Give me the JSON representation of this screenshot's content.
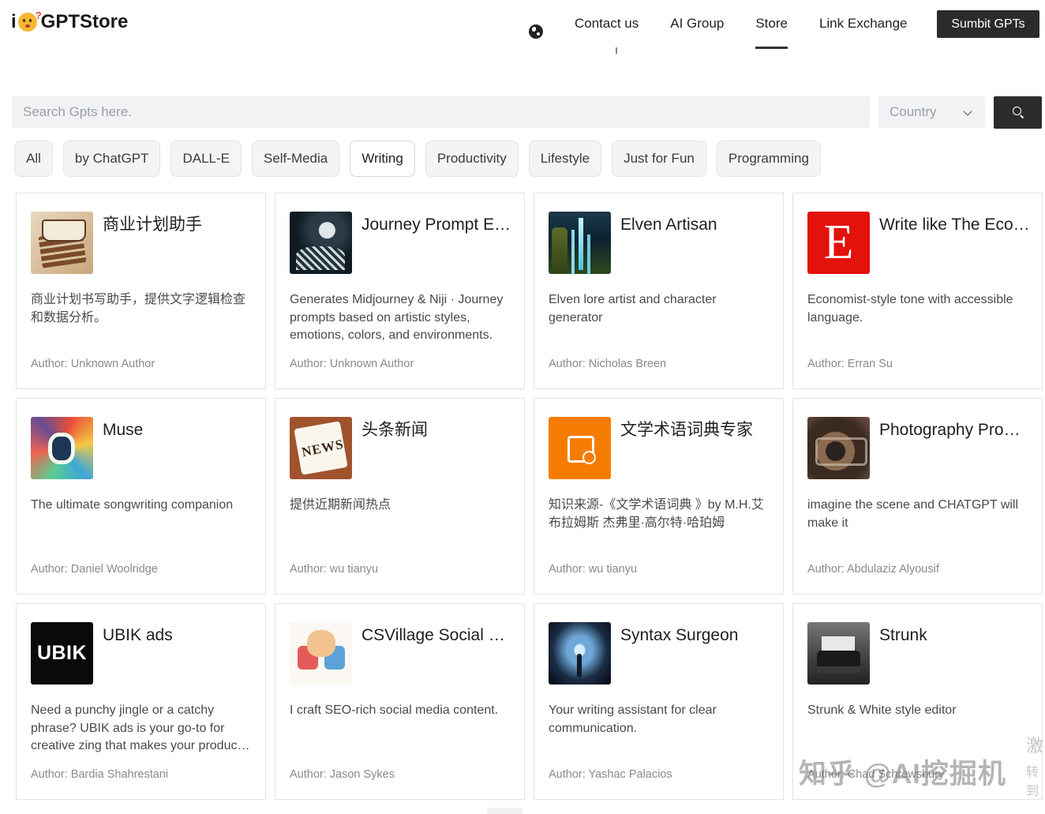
{
  "header": {
    "logo_prefix": "i",
    "logo_text": "GPTStore",
    "nav": [
      "Contact us",
      "AI Group",
      "Store",
      "Link Exchange"
    ],
    "active_nav": "Store",
    "submit_label": "Sumbit GPTs"
  },
  "search": {
    "placeholder": "Search Gpts here.",
    "country_label": "Country"
  },
  "categories": [
    "All",
    "by ChatGPT",
    "DALL-E",
    "Self-Media",
    "Writing",
    "Productivity",
    "Lifestyle",
    "Just for Fun",
    "Programming"
  ],
  "active_category": "Writing",
  "cards": [
    {
      "thumb": "book-stack-image",
      "title": "商业计划助手",
      "desc": "商业计划书写助手，提供文字逻辑检查和数据分析。",
      "author": "Author: Unknown Author"
    },
    {
      "thumb": "journey-illustration-image",
      "title": "Journey Prompt Expert",
      "desc": "Generates Midjourney & Niji · Journey prompts based on artistic styles, emotions, colors, and environments.",
      "author": "Author: Unknown Author"
    },
    {
      "thumb": "elven-forest-image",
      "title": "Elven Artisan",
      "desc": "Elven lore artist and character generator",
      "author": "Author: Nicholas Breen"
    },
    {
      "thumb": "economist-logo-image",
      "title": "Write like The Economist",
      "desc": "Economist-style tone with accessible language.",
      "author": "Author: Erran Su"
    },
    {
      "thumb": "colorful-music-art-image",
      "title": "Muse",
      "desc": "The ultimate songwriting companion",
      "author": "Author: Daniel Woolridge"
    },
    {
      "thumb": "newspaper-image",
      "title": "头条新闻",
      "desc": "提供近期新闻热点",
      "author": "Author: wu tianyu"
    },
    {
      "thumb": "image-placeholder-icon",
      "title": "文学术语词典专家",
      "desc": "知识来源-《文学术语词典 》by M.H.艾布拉姆斯 杰弗里·高尔特·哈珀姆",
      "author": "Author: wu tianyu"
    },
    {
      "thumb": "vintage-camera-image",
      "title": "Photography Prompts",
      "desc": "imagine the scene and CHATGPT will make it",
      "author": "Author: Abdulaziz Alyousif"
    },
    {
      "thumb": "ubik-logo-image",
      "title": "UBIK ads",
      "desc": "Need a punchy jingle or a catchy phrase? UBIK ads is your go-to for creative zing that makes your products shine.",
      "author": "Author: Bardia Shahrestani"
    },
    {
      "thumb": "puzzle-cat-image",
      "title": "CSVillage Social Studio",
      "desc": "I craft SEO-rich social media content.",
      "author": "Author: Jason Sykes"
    },
    {
      "thumb": "data-tunnel-image",
      "title": "Syntax Surgeon",
      "desc": "Your writing assistant for clear communication.",
      "author": "Author: Yashac Palacios"
    },
    {
      "thumb": "typewriter-image",
      "title": "Strunk",
      "desc": "Strunk & White style editor",
      "author": "Author: Chad Schrewsbury"
    }
  ],
  "econ_letter": "E",
  "ubik_text": "UBIK",
  "watermark": "知乎 @AI挖掘机",
  "side_watermark": [
    "激",
    "转到"
  ]
}
